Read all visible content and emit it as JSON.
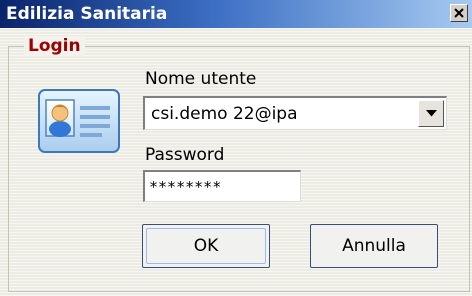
{
  "window": {
    "title": "Edilizia Sanitaria",
    "close_symbol": "×"
  },
  "login": {
    "group_label": "Login",
    "icon": "contact-card-icon",
    "username": {
      "label": "Nome utente",
      "value": "csi.demo 22@ipa"
    },
    "password": {
      "label": "Password",
      "value": "********"
    },
    "ok_label": "OK",
    "cancel_label": "Annulla"
  },
  "colors": {
    "legend_text": "#9c0000",
    "titlebar_start": "#0a246a",
    "titlebar_end": "#a6caf0"
  }
}
